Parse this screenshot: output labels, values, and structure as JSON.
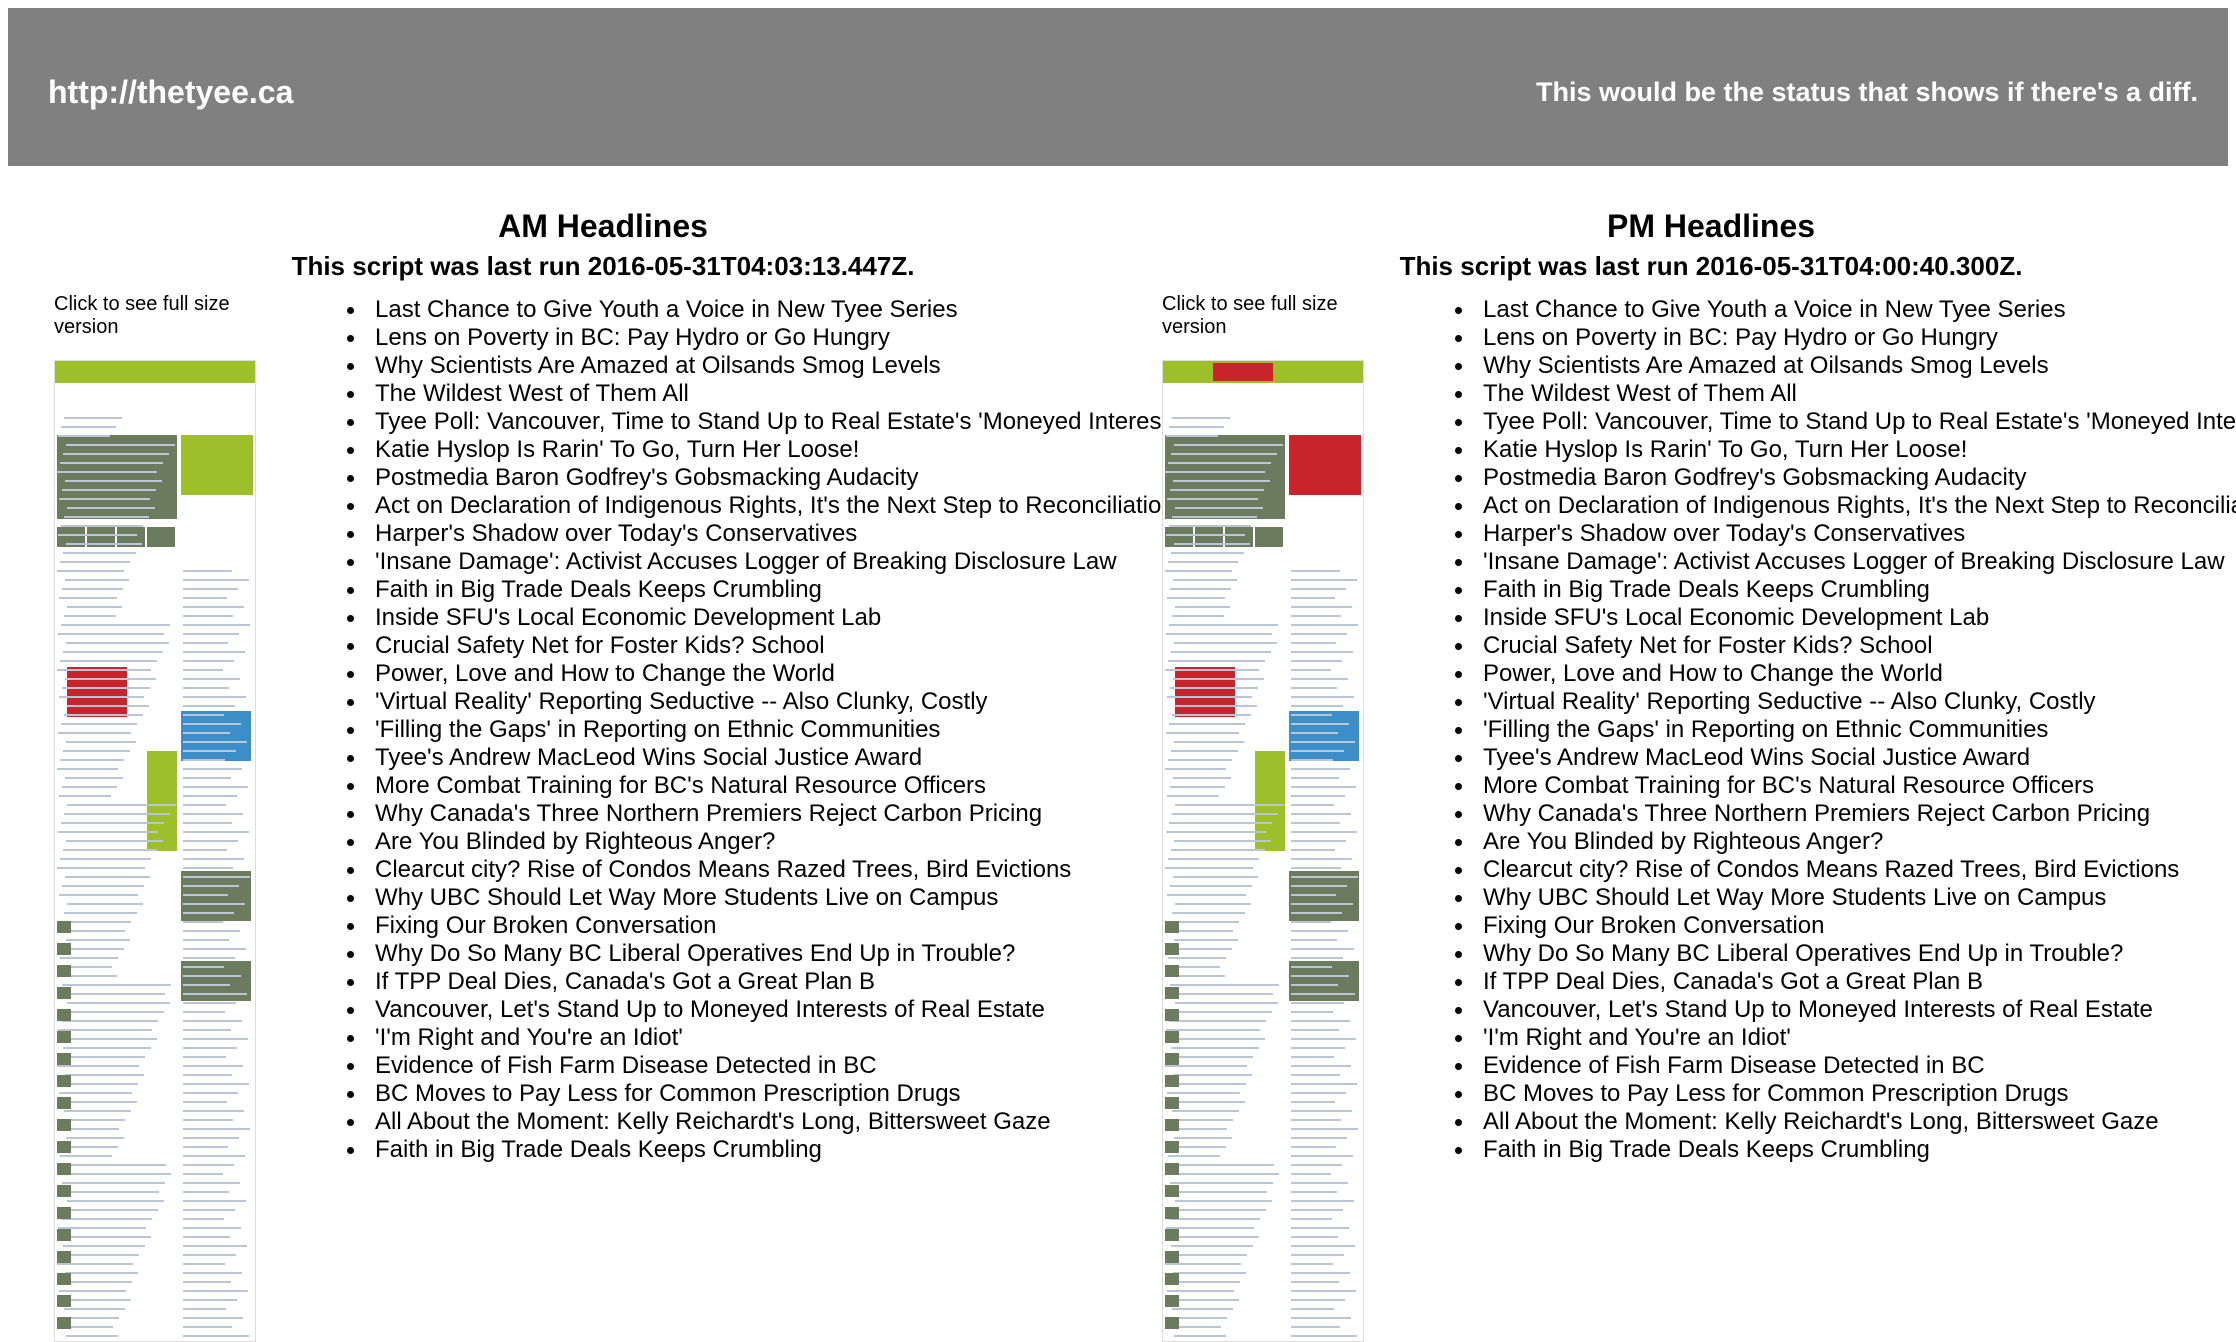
{
  "header": {
    "url": "http://thetyee.ca",
    "status": "This would be the status that shows if there's a diff."
  },
  "columns": [
    {
      "id": "am",
      "title": "AM Headlines",
      "last_run": "This script was last run 2016-05-31T04:03:13.447Z.",
      "thumb_caption": "Click to see full size version",
      "headlines": [
        "Last Chance to Give Youth a Voice in New Tyee Series",
        "Lens on Poverty in BC: Pay Hydro or Go Hungry",
        "Why Scientists Are Amazed at Oilsands Smog Levels",
        "The Wildest West of Them All",
        "Tyee Poll: Vancouver, Time to Stand Up to Real Estate's 'Moneyed Interests'?",
        "Katie Hyslop Is Rarin' To Go, Turn Her Loose!",
        "Postmedia Baron Godfrey's Gobsmacking Audacity",
        "Act on Declaration of Indigenous Rights, It's the Next Step to Reconciliation",
        "Harper's Shadow over Today's Conservatives",
        "'Insane Damage': Activist Accuses Logger of Breaking Disclosure Law",
        "Faith in Big Trade Deals Keeps Crumbling",
        "Inside SFU's Local Economic Development Lab",
        "Crucial Safety Net for Foster Kids? School",
        "Power, Love and How to Change the World",
        "'Virtual Reality' Reporting Seductive -- Also Clunky, Costly",
        "'Filling the Gaps' in Reporting on Ethnic Communities",
        "Tyee's Andrew MacLeod Wins Social Justice Award",
        "More Combat Training for BC's Natural Resource Officers",
        "Why Canada's Three Northern Premiers Reject Carbon Pricing",
        "Are You Blinded by Righteous Anger?",
        "Clearcut city? Rise of Condos Means Razed Trees, Bird Evictions",
        "Why UBC Should Let Way More Students Live on Campus",
        "Fixing Our Broken Conversation",
        "Why Do So Many BC Liberal Operatives End Up in Trouble?",
        "If TPP Deal Dies, Canada's Got a Great Plan B",
        "Vancouver, Let's Stand Up to Moneyed Interests of Real Estate",
        "'I'm Right and You're an Idiot'",
        "Evidence of Fish Farm Disease Detected in BC",
        "BC Moves to Pay Less for Common Prescription Drugs",
        "All About the Moment: Kelly Reichardt's Long, Bittersweet Gaze",
        "Faith in Big Trade Deals Keeps Crumbling"
      ]
    },
    {
      "id": "pm",
      "title": "PM Headlines",
      "last_run": "This script was last run 2016-05-31T04:00:40.300Z.",
      "thumb_caption": "Click to see full size version",
      "headlines": [
        "Last Chance to Give Youth a Voice in New Tyee Series",
        "Lens on Poverty in BC: Pay Hydro or Go Hungry",
        "Why Scientists Are Amazed at Oilsands Smog Levels",
        "The Wildest West of Them All",
        "Tyee Poll: Vancouver, Time to Stand Up to Real Estate's 'Moneyed Interests'?",
        "Katie Hyslop Is Rarin' To Go, Turn Her Loose!",
        "Postmedia Baron Godfrey's Gobsmacking Audacity",
        "Act on Declaration of Indigenous Rights, It's the Next Step to Reconciliation",
        "Harper's Shadow over Today's Conservatives",
        "'Insane Damage': Activist Accuses Logger of Breaking Disclosure Law",
        "Faith in Big Trade Deals Keeps Crumbling",
        "Inside SFU's Local Economic Development Lab",
        "Crucial Safety Net for Foster Kids? School",
        "Power, Love and How to Change the World",
        "'Virtual Reality' Reporting Seductive -- Also Clunky, Costly",
        "'Filling the Gaps' in Reporting on Ethnic Communities",
        "Tyee's Andrew MacLeod Wins Social Justice Award",
        "More Combat Training for BC's Natural Resource Officers",
        "Why Canada's Three Northern Premiers Reject Carbon Pricing",
        "Are You Blinded by Righteous Anger?",
        "Clearcut city? Rise of Condos Means Razed Trees, Bird Evictions",
        "Why UBC Should Let Way More Students Live on Campus",
        "Fixing Our Broken Conversation",
        "Why Do So Many BC Liberal Operatives End Up in Trouble?",
        "If TPP Deal Dies, Canada's Got a Great Plan B",
        "Vancouver, Let's Stand Up to Moneyed Interests of Real Estate",
        "'I'm Right and You're an Idiot'",
        "Evidence of Fish Farm Disease Detected in BC",
        "BC Moves to Pay Less for Common Prescription Drugs",
        "All About the Moment: Kelly Reichardt's Long, Bittersweet Gaze",
        "Faith in Big Trade Deals Keeps Crumbling"
      ]
    }
  ]
}
